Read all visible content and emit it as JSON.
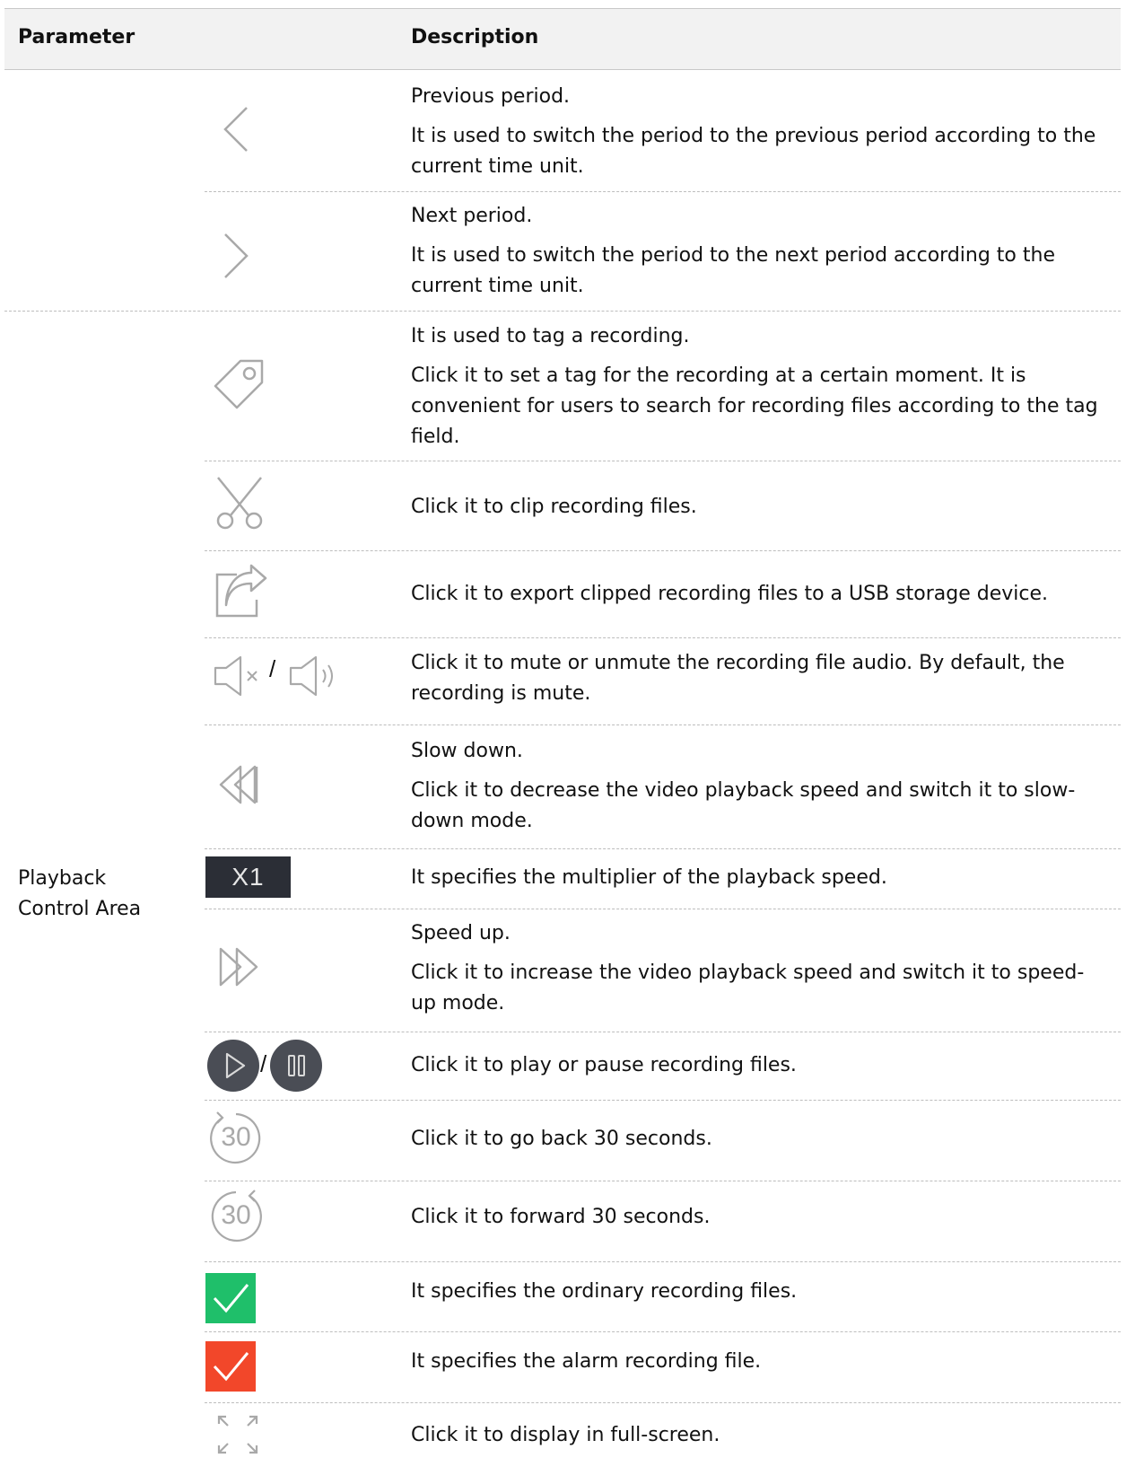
{
  "table": {
    "headers": {
      "parameter": "Parameter",
      "description": "Description"
    },
    "group_label": "Playback\nControl Area",
    "rows": [
      {
        "icon": "chevron-left-icon",
        "lines": [
          "Previous period.",
          "It is used to switch the period to the previous period according to the current time unit."
        ]
      },
      {
        "icon": "chevron-right-icon",
        "lines": [
          "Next period.",
          "It is used to switch the period to the next period according to the current time unit."
        ]
      },
      {
        "icon": "tag-icon",
        "lines": [
          "It is used to tag a recording.",
          "Click it to set a tag for the recording at a certain moment. It is convenient for users to search for recording files according to the tag field."
        ]
      },
      {
        "icon": "scissors-icon",
        "lines": [
          "Click it to clip recording files."
        ]
      },
      {
        "icon": "export-icon",
        "lines": [
          "Click it to export clipped recording files to a USB storage device."
        ]
      },
      {
        "icon": "mute-unmute-icon",
        "icon_separator": "/",
        "lines": [
          "Click it to mute or unmute the recording file audio. By default, the recording is mute."
        ]
      },
      {
        "icon": "rewind-icon",
        "lines": [
          "Slow down.",
          "Click it to decrease the video playback speed and switch it to slow-down mode."
        ]
      },
      {
        "icon": "speed-multiplier-badge",
        "badge_text": "X1",
        "lines": [
          "It specifies the multiplier of the playback speed."
        ]
      },
      {
        "icon": "fast-forward-icon",
        "lines": [
          "Speed up.",
          "Click it to increase the video playback speed and switch it to speed-up mode."
        ]
      },
      {
        "icon": "play-pause-icon",
        "icon_separator": "/",
        "lines": [
          "Click it to play or pause recording files."
        ]
      },
      {
        "icon": "back-30-icon",
        "icon_text": "30",
        "lines": [
          "Click it to go back 30 seconds."
        ]
      },
      {
        "icon": "forward-30-icon",
        "icon_text": "30",
        "lines": [
          "Click it to forward 30 seconds."
        ]
      },
      {
        "icon": "ordinary-recording-check-icon",
        "lines": [
          "It specifies the ordinary recording files."
        ]
      },
      {
        "icon": "alarm-recording-check-icon",
        "lines": [
          "It specifies the alarm recording file."
        ]
      },
      {
        "icon": "fullscreen-icon",
        "lines": [
          "Click it to display in full-screen."
        ]
      }
    ]
  },
  "colors": {
    "icon_gray": "#a9a9a9",
    "badge_bg": "#2b2e36",
    "play_circle": "#4a4d55",
    "ordinary_green": "#1fbf6a",
    "alarm_red": "#f2472a",
    "header_bg": "#f2f2f2"
  }
}
